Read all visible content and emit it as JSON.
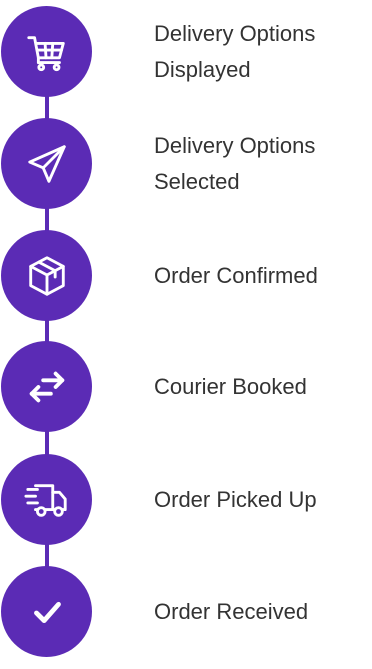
{
  "accent_color": "#5b2bb5",
  "steps": [
    {
      "icon": "shopping-cart-icon",
      "line1": "Delivery Options",
      "line2": "Displayed"
    },
    {
      "icon": "paper-plane-icon",
      "line1": "Delivery Options",
      "line2": "Selected"
    },
    {
      "icon": "box-icon",
      "line1": "Order Confirmed",
      "line2": ""
    },
    {
      "icon": "exchange-arrows-icon",
      "line1": "Courier Booked",
      "line2": ""
    },
    {
      "icon": "delivery-truck-icon",
      "line1": "Order Picked Up",
      "line2": ""
    },
    {
      "icon": "checkmark-icon",
      "line1": "Order Received",
      "line2": ""
    }
  ]
}
